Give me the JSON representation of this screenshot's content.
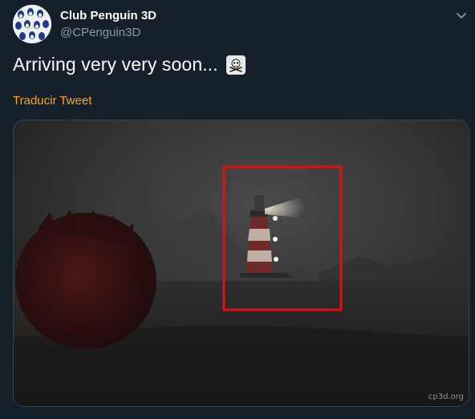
{
  "tweet": {
    "author_name": "Club Penguin 3D",
    "author_handle": "@CPenguin3D",
    "text": "Arriving very very soon...",
    "emoji_icon": "skull-and-crossbones",
    "translate_label": "Traducir Tweet",
    "media": {
      "watermark": "cp3d.org",
      "highlight_color": "#e01010"
    }
  },
  "colors": {
    "background": "#15202b",
    "text_primary": "#ffffff",
    "text_secondary": "#8899a6",
    "link": "#f5a623",
    "border": "#38444d"
  }
}
